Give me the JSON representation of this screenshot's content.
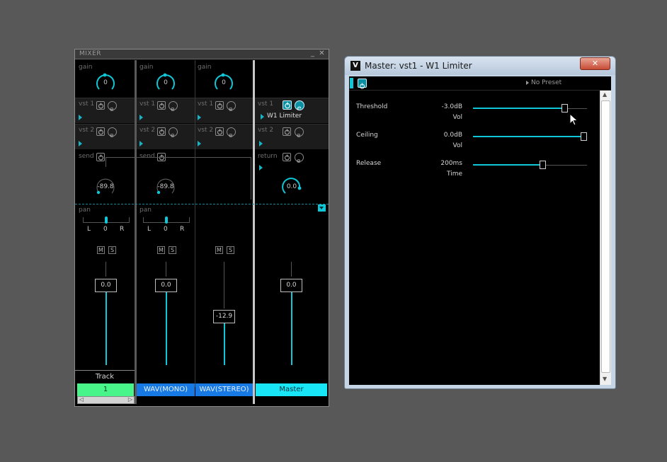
{
  "colors": {
    "accent": "#10c7d8",
    "track_green": "#48f58a",
    "wav_blue": "#1779e4",
    "master_cyan": "#18e6f7"
  },
  "mixer": {
    "title": "MIXER",
    "minimize": "_",
    "close": "✕",
    "strips": [
      {
        "gain_label": "gain",
        "gain_value": "0",
        "vst1_label": "vst 1",
        "vst2_label": "vst 2",
        "send_label": "send",
        "send_value": "-89.8",
        "pan_label": "pan",
        "pan_left": "L",
        "pan_center": "0",
        "pan_right": "R",
        "mute": "M",
        "solo": "S",
        "fader_value": "0.0",
        "type_label": "Track",
        "name": "1"
      },
      {
        "gain_label": "gain",
        "gain_value": "0",
        "vst1_label": "vst 1",
        "vst2_label": "vst 2",
        "send_label": "send",
        "send_value": "-89.8",
        "pan_label": "pan",
        "pan_left": "L",
        "pan_center": "0",
        "pan_right": "R",
        "mute": "M",
        "solo": "S",
        "fader_value": "0.0",
        "name": "WAV(MONO)"
      },
      {
        "gain_label": "gain",
        "gain_value": "0",
        "vst1_label": "vst 1",
        "vst2_label": "vst 2",
        "mute": "M",
        "solo": "S",
        "fader_value": "-12.9",
        "name": "WAV(STEREO)"
      },
      {
        "vst1_label": "vst 1",
        "vst1_plugin": "W1 Limiter",
        "vst2_label": "vst 2",
        "return_label": "return",
        "return_value": "0.0",
        "fader_value": "0.0",
        "name": "Master"
      }
    ]
  },
  "limiter": {
    "title": "Master: vst1 - W1 Limiter",
    "app_icon": "V",
    "close": "✕",
    "preset": "No Preset",
    "params": [
      {
        "name": "Threshold",
        "value": "-3.0dB",
        "unit": "Vol",
        "level": 0.82
      },
      {
        "name": "Ceiling",
        "value": "0.0dB",
        "unit": "Vol",
        "level": 1.0
      },
      {
        "name": "Release",
        "value": "200ms",
        "unit": "Time",
        "level": 0.62
      }
    ]
  }
}
